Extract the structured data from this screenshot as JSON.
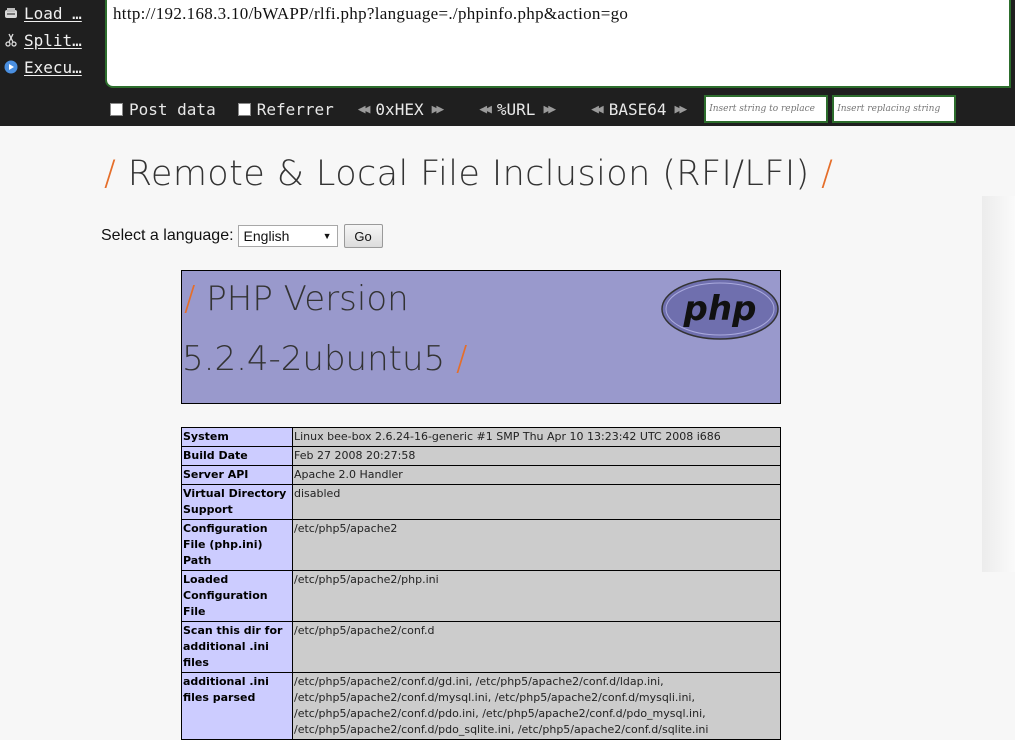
{
  "hackbar": {
    "actions": [
      {
        "label": "Load …",
        "icon": "load-url-icon"
      },
      {
        "label": "Split…",
        "icon": "split-url-icon"
      },
      {
        "label": "Execu…",
        "icon": "execute-icon"
      }
    ],
    "url": "http://192.168.3.10/bWAPP/rlfi.php?language=./phpinfo.php&action=go",
    "post_data_label": "Post data",
    "referrer_label": "Referrer",
    "encoders": [
      "0xHEX",
      "%URL",
      "BASE64"
    ],
    "insert_string_placeholder": "Insert string to replace",
    "insert_replacing_placeholder": "Insert replacing string",
    "accent_color": "#2d6e2d"
  },
  "page": {
    "title_slash_left": "/",
    "title": "Remote & Local File Inclusion (RFI/LFI)",
    "title_slash_right": "/",
    "language_label": "Select a language:",
    "language_selected": "English",
    "go_label": "Go",
    "accent_color": "#e56e2a"
  },
  "phpinfo": {
    "header_slash": "/",
    "header_line1": "PHP Version",
    "header_line2": "5.2.4-2ubuntu5",
    "logo_text": "php",
    "rows": [
      {
        "key": "System",
        "value": "Linux bee-box 2.6.24-16-generic #1 SMP Thu Apr 10 13:23:42 UTC 2008 i686"
      },
      {
        "key": "Build Date",
        "value": "Feb 27 2008 20:27:58"
      },
      {
        "key": "Server API",
        "value": "Apache 2.0 Handler"
      },
      {
        "key": "Virtual Directory Support",
        "value": "disabled"
      },
      {
        "key": "Configuration File (php.ini) Path",
        "value": "/etc/php5/apache2"
      },
      {
        "key": "Loaded Configuration File",
        "value": "/etc/php5/apache2/php.ini"
      },
      {
        "key": "Scan this dir for additional .ini files",
        "value": "/etc/php5/apache2/conf.d"
      },
      {
        "key": "additional .ini files parsed",
        "value": "/etc/php5/apache2/conf.d/gd.ini, /etc/php5/apache2/conf.d/ldap.ini, /etc/php5/apache2/conf.d/mysql.ini, /etc/php5/apache2/conf.d/mysqli.ini, /etc/php5/apache2/conf.d/pdo.ini, /etc/php5/apache2/conf.d/pdo_mysql.ini, /etc/php5/apache2/conf.d/pdo_sqlite.ini, /etc/php5/apache2/conf.d/sqlite.ini"
      }
    ]
  }
}
